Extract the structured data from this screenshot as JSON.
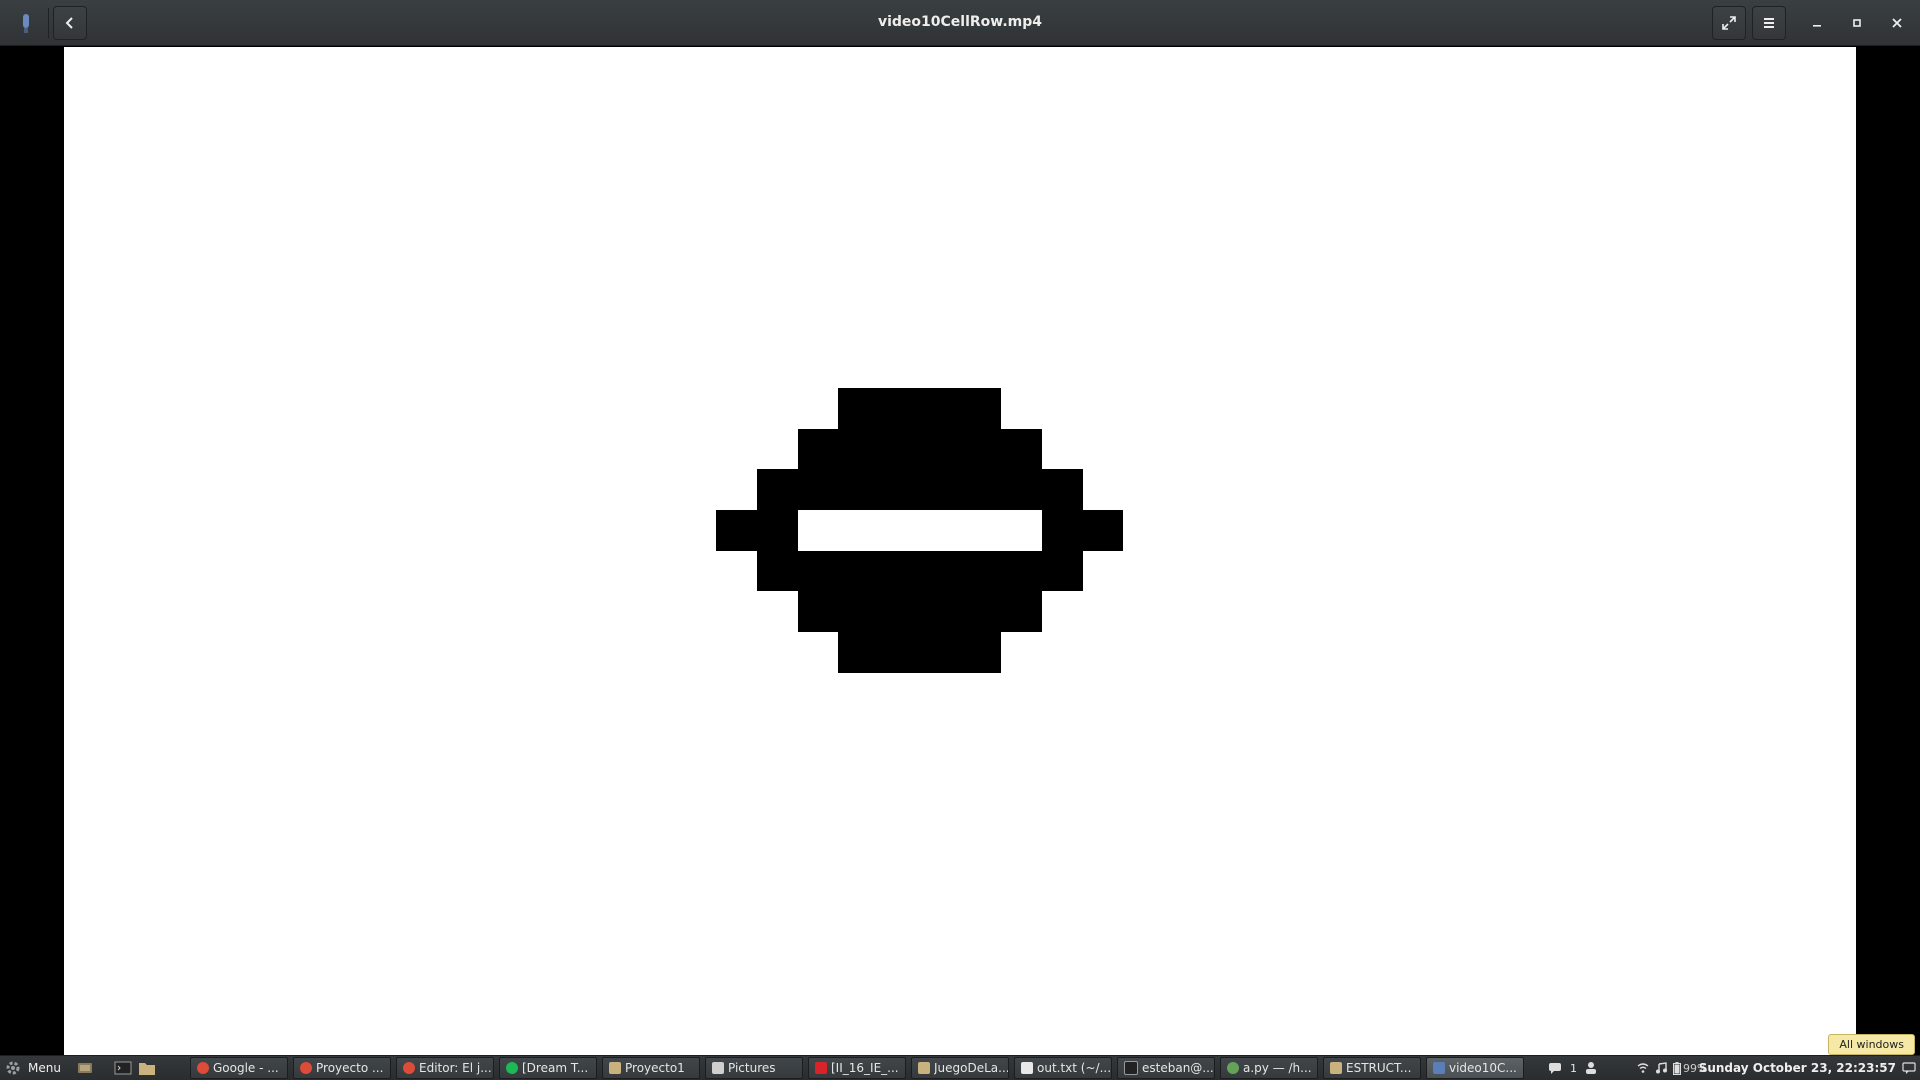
{
  "window": {
    "title": "video10CellRow.mp4",
    "back_button": "back",
    "fullscreen_button": "fullscreen",
    "menu_button": "menu",
    "minimize": "minimize",
    "maximize": "maximize",
    "close": "close"
  },
  "video": {
    "background": "#ffffff",
    "foreground": "#000000"
  },
  "tooltip": "All windows",
  "taskbar": {
    "menu_label": "Menu",
    "tasks": [
      {
        "label": "Google - ...",
        "icon": "chrome-icon"
      },
      {
        "label": "Proyecto ...",
        "icon": "chrome-icon"
      },
      {
        "label": "Editor: El j...",
        "icon": "chrome-icon"
      },
      {
        "label": "[Dream T...",
        "icon": "spotify-icon"
      },
      {
        "label": "Proyecto1",
        "icon": "folder-icon"
      },
      {
        "label": "Pictures",
        "icon": "document-icon"
      },
      {
        "label": "[II_16_IE_...",
        "icon": "pdf-icon"
      },
      {
        "label": "JuegoDeLa...",
        "icon": "folder-icon"
      },
      {
        "label": "out.txt (~/...",
        "icon": "text-editor-icon"
      },
      {
        "label": "esteban@...",
        "icon": "terminal-icon"
      },
      {
        "label": "a.py — /h...",
        "icon": "atom-icon"
      },
      {
        "label": "ESTRUCT...",
        "icon": "folder-icon"
      },
      {
        "label": "video10C...",
        "icon": "video-icon"
      }
    ],
    "notification_count": "1",
    "battery": "99%",
    "clock": "Sunday October 23, 22:23:57"
  }
}
